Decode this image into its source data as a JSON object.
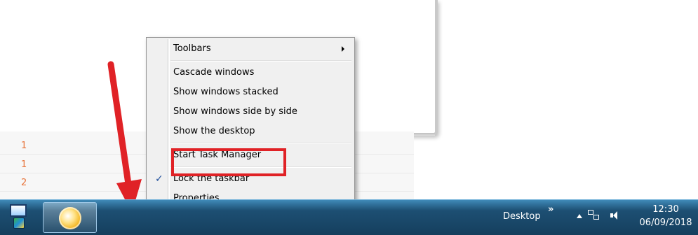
{
  "background": {
    "rows": [
      {
        "num": "1"
      },
      {
        "num": "1"
      },
      {
        "num": "2"
      }
    ]
  },
  "context_menu": {
    "items": [
      {
        "label": "Toolbars",
        "has_submenu": true
      },
      {
        "label": "Cascade windows"
      },
      {
        "label": "Show windows stacked"
      },
      {
        "label": "Show windows side by side"
      },
      {
        "label": "Show the desktop"
      },
      {
        "label": "Start Task Manager",
        "highlighted": true
      },
      {
        "label": "Lock the taskbar",
        "checked": true
      },
      {
        "label": "Properties"
      }
    ],
    "check_glyph": "✓"
  },
  "taskbar": {
    "desktop_label": "Desktop",
    "chevrons": "»",
    "clock_time": "12:30",
    "clock_date": "06/09/2018"
  },
  "colors": {
    "highlight_border": "#e02226",
    "arrow": "#e02226",
    "taskbar": "#1d4f73"
  }
}
